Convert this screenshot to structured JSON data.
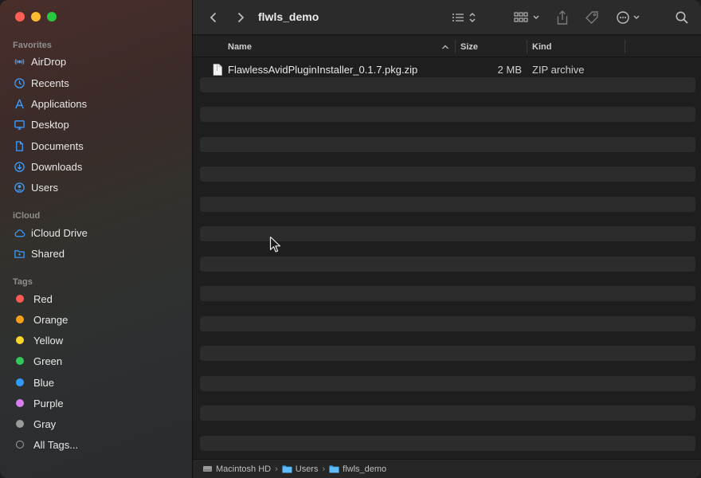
{
  "window": {
    "folder_title": "flwls_demo"
  },
  "sidebar": {
    "favorites_title": "Favorites",
    "favorites": [
      {
        "label": "AirDrop",
        "icon": "airdrop-icon"
      },
      {
        "label": "Recents",
        "icon": "clock-icon"
      },
      {
        "label": "Applications",
        "icon": "applications-icon"
      },
      {
        "label": "Desktop",
        "icon": "desktop-icon"
      },
      {
        "label": "Documents",
        "icon": "document-icon"
      },
      {
        "label": "Downloads",
        "icon": "download-icon"
      },
      {
        "label": "Users",
        "icon": "user-icon"
      }
    ],
    "icloud_title": "iCloud",
    "icloud": [
      {
        "label": "iCloud Drive",
        "icon": "cloud-icon"
      },
      {
        "label": "Shared",
        "icon": "shared-folder-icon"
      }
    ],
    "tags_title": "Tags",
    "tags": [
      {
        "label": "Red",
        "color": "#ff5a52"
      },
      {
        "label": "Orange",
        "color": "#f7a11a"
      },
      {
        "label": "Yellow",
        "color": "#f8d52a"
      },
      {
        "label": "Green",
        "color": "#34c759"
      },
      {
        "label": "Blue",
        "color": "#2f9bff"
      },
      {
        "label": "Purple",
        "color": "#d77ef0"
      },
      {
        "label": "Gray",
        "color": "#9a9a9a"
      },
      {
        "label": "All Tags...",
        "color": ""
      }
    ]
  },
  "columns": {
    "name": "Name",
    "size": "Size",
    "kind": "Kind"
  },
  "files": [
    {
      "name": "FlawlessAvidPluginInstaller_0.1.7.pkg.zip",
      "size": "2 MB",
      "kind": "ZIP archive"
    }
  ],
  "pathbar": [
    {
      "label": "Macintosh HD",
      "icon": "hard-drive-icon"
    },
    {
      "label": "Users",
      "icon": "folder-icon"
    },
    {
      "label": "flwls_demo",
      "icon": "folder-icon"
    }
  ],
  "colors": {
    "accent": "#2f9bff",
    "sidebar_icon": "#3c9dff"
  }
}
